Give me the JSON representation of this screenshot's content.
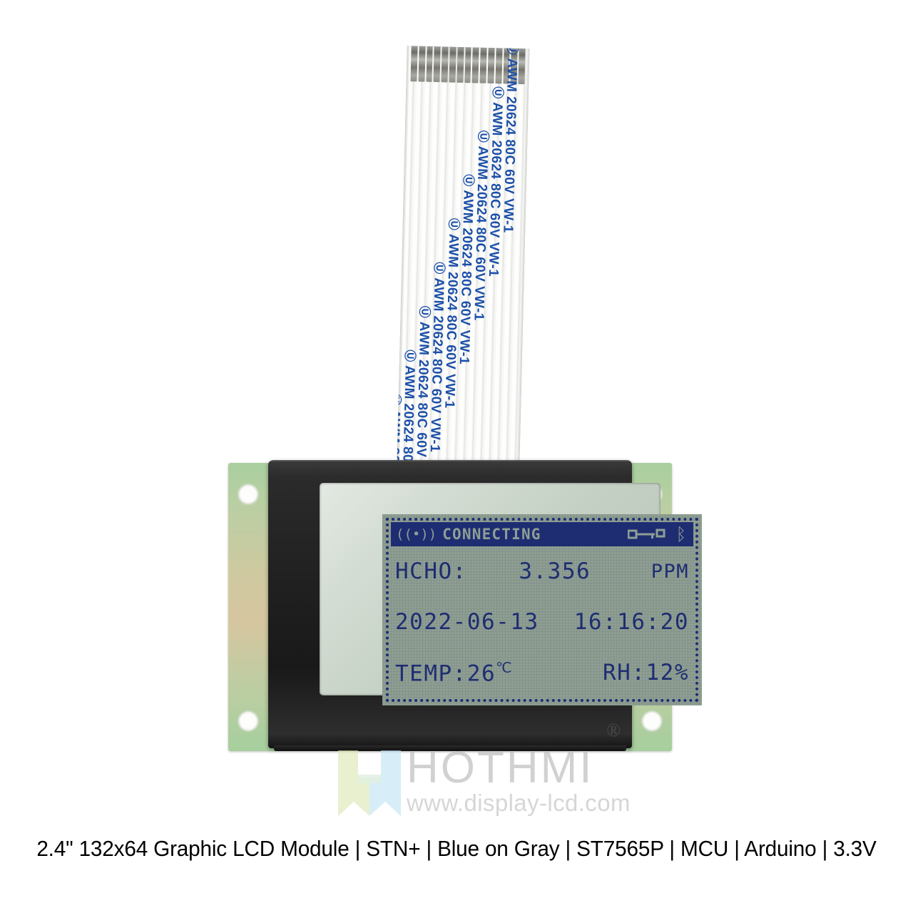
{
  "product": {
    "caption": "2.4\" 132x64 Graphic LCD Module | STN+ | Blue on Gray | ST7565P | MCU | Arduino | 3.3V"
  },
  "cable": {
    "marking": "AWM 20624 80C 60V VW-1",
    "ul_symbol": "Ⓤ",
    "text_color": "#1b4fa8",
    "repeat_count": 9
  },
  "lcd": {
    "resolution": "132x64",
    "background_color": "#8e9e93",
    "pixel_color": "#1e2d72",
    "status_bar": {
      "signal_icon": "((•))",
      "title": "CONNECTING",
      "usb_icon": "usb-icon",
      "bluetooth_icon": "ᛒ"
    },
    "rows": {
      "hcho": {
        "label": "HCHO:",
        "value": "3.356",
        "unit": "PPM"
      },
      "datetime": {
        "date": "2022-06-13",
        "time": "16:16:20"
      },
      "environment": {
        "temp_label": "TEMP:",
        "temp_value": "26",
        "temp_unit": "℃",
        "humidity": "RH:12%"
      }
    }
  },
  "module": {
    "pcb_color": "#b6cfa2",
    "bezel_color": "#1f1f1f",
    "trademark": "®"
  },
  "watermark": {
    "brand": "HOTHMI",
    "url": "www.display-lcd.com",
    "logo_left_color": "#dde8b4",
    "logo_right_color": "#bfe4f5"
  }
}
